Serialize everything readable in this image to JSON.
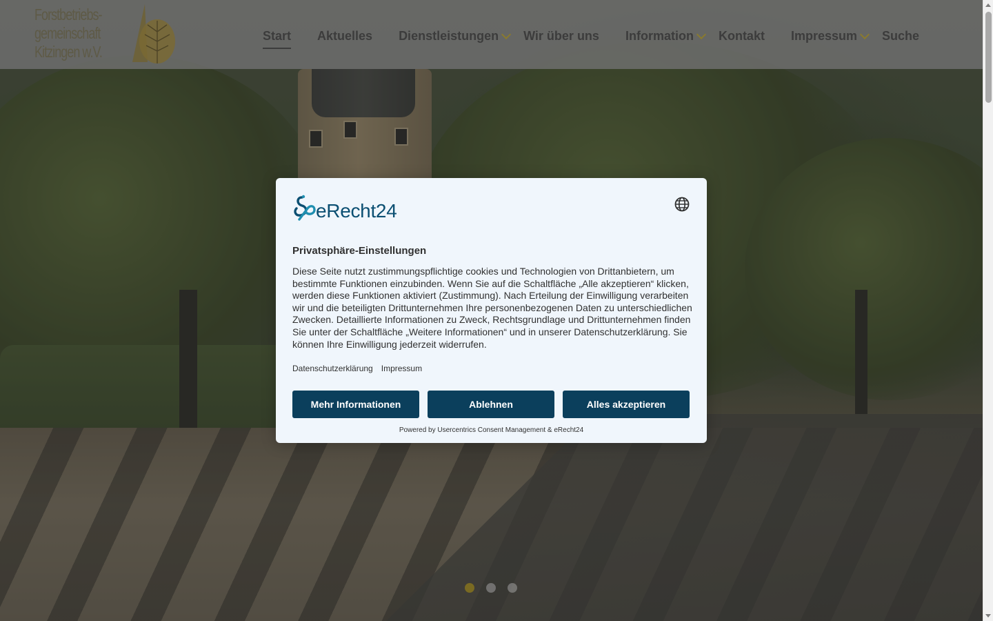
{
  "header": {
    "logo_lines": [
      "Forstbetriebs-",
      "gemeinschaft",
      "Kitzingen w.V."
    ],
    "nav": [
      {
        "label": "Start",
        "active": true,
        "dropdown": false
      },
      {
        "label": "Aktuelles",
        "active": false,
        "dropdown": false
      },
      {
        "label": "Dienstleistungen",
        "active": false,
        "dropdown": true
      },
      {
        "label": "Wir über uns",
        "active": false,
        "dropdown": false
      },
      {
        "label": "Information",
        "active": false,
        "dropdown": true
      },
      {
        "label": "Kontakt",
        "active": false,
        "dropdown": false
      },
      {
        "label": "Impressum",
        "active": false,
        "dropdown": true
      },
      {
        "label": "Suche",
        "active": false,
        "dropdown": false
      }
    ]
  },
  "carousel": {
    "slide_count": 3,
    "active_index": 0
  },
  "consent": {
    "brand": "eRecht24",
    "language_icon": "globe-icon",
    "title": "Privatsphäre-Einstellungen",
    "text": "Diese Seite nutzt zustimmungspflichtige cookies und Technologien von Drittanbietern, um bestimmte Funktionen einzubinden. Wenn Sie auf die Schaltfläche „Alle akzeptieren“ klicken, werden diese Funktionen aktiviert (Zustimmung). Nach Erteilung der Einwilligung verarbeiten wir und die beteiligten Drittunternehmen Ihre personenbezogenen Daten zu unterschiedlichen Zwecken. Detaillierte Informationen zu Zweck, Rechtsgrundlage und Drittunternehmen finden Sie unter der Schaltfläche „Weitere Informationen“ und in unserer Datenschutzerklärung. Sie können Ihre Einwilligung jederzeit widerrufen.",
    "links": {
      "privacy": "Datenschutzerklärung",
      "imprint": "Impressum"
    },
    "buttons": {
      "more": "Mehr Informationen",
      "decline": "Ablehnen",
      "accept": "Alles akzeptieren"
    },
    "powered_by": "Powered by Usercentrics Consent Management & eRecht24"
  },
  "colors": {
    "accent_gold": "#7a6a22",
    "button_navy": "#0b3f5c",
    "modal_bg": "#f0f6fc",
    "brand_blue": "#0b4f72"
  }
}
